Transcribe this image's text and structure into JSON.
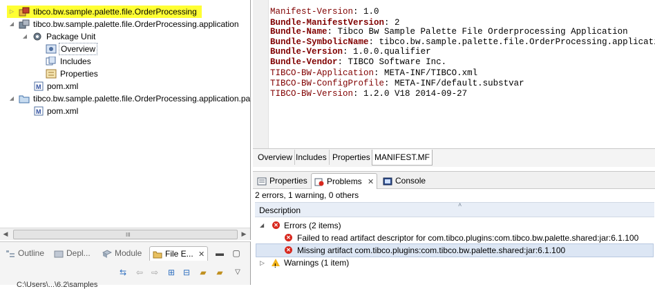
{
  "tree": {
    "items": [
      {
        "label": "tibco.bw.sample.palette.file.OrderProcessing"
      },
      {
        "label": "tibco.bw.sample.palette.file.OrderProcessing.application"
      },
      {
        "label": "Package Unit"
      },
      {
        "label": "Overview"
      },
      {
        "label": "Includes"
      },
      {
        "label": "Properties"
      },
      {
        "label": "pom.xml"
      },
      {
        "label": "tibco.bw.sample.palette.file.OrderProcessing.application.pa"
      },
      {
        "label": "pom.xml"
      }
    ],
    "scroll_grip": "III"
  },
  "left_views": {
    "tabs": [
      {
        "label": "Outline"
      },
      {
        "label": "Depl..."
      },
      {
        "label": "Module"
      },
      {
        "label": "File E..."
      }
    ],
    "bottom_text": "C:\\Users\\...\\6.2\\samples"
  },
  "manifest": {
    "lines": [
      {
        "key": "Manifest-Version",
        "value": "1.0",
        "bold": false
      },
      {
        "key": "Bundle-ManifestVersion",
        "value": "2",
        "bold": true
      },
      {
        "key": "Bundle-Name",
        "value": "Tibco Bw Sample Palette File Orderprocessing Application",
        "bold": true
      },
      {
        "key": "Bundle-SymbolicName",
        "value": "tibco.bw.sample.palette.file.OrderProcessing.application",
        "bold": true
      },
      {
        "key": "Bundle-Version",
        "value": "1.0.0.qualifier",
        "bold": true
      },
      {
        "key": "Bundle-Vendor",
        "value": "TIBCO Software Inc.",
        "bold": true
      },
      {
        "key": "TIBCO-BW-Application",
        "value": "META-INF/TIBCO.xml",
        "bold": false
      },
      {
        "key": "TIBCO-BW-ConfigProfile",
        "value": "META-INF/default.substvar",
        "bold": false
      },
      {
        "key": "TIBCO-BW-Version",
        "value": "1.2.0 V18 2014-09-27",
        "bold": false
      }
    ]
  },
  "editor_tabs": [
    {
      "label": "Overview"
    },
    {
      "label": "Includes"
    },
    {
      "label": "Properties"
    },
    {
      "label": "MANIFEST.MF"
    }
  ],
  "panel": {
    "tabs": [
      {
        "label": "Properties"
      },
      {
        "label": "Problems"
      },
      {
        "label": "Console"
      }
    ],
    "close_glyph": "✕",
    "summary": "2 errors, 1 warning, 0 others",
    "column": "Description",
    "groups": {
      "errors": "Errors (2 items)",
      "warnings": "Warnings (1 item)"
    },
    "errors": [
      "Failed to read artifact descriptor for com.tibco.plugins:com.tibco.bw.palette.shared:jar:6.1.100",
      "Missing artifact com.tibco.plugins:com.tibco.bw.palette.shared:jar:6.1.100"
    ]
  },
  "colors": {
    "highlight": "#ffff33",
    "manifest_key": "#800000",
    "error": "#d8281e",
    "warning": "#f2b31a",
    "selection": "#dce6f4"
  }
}
